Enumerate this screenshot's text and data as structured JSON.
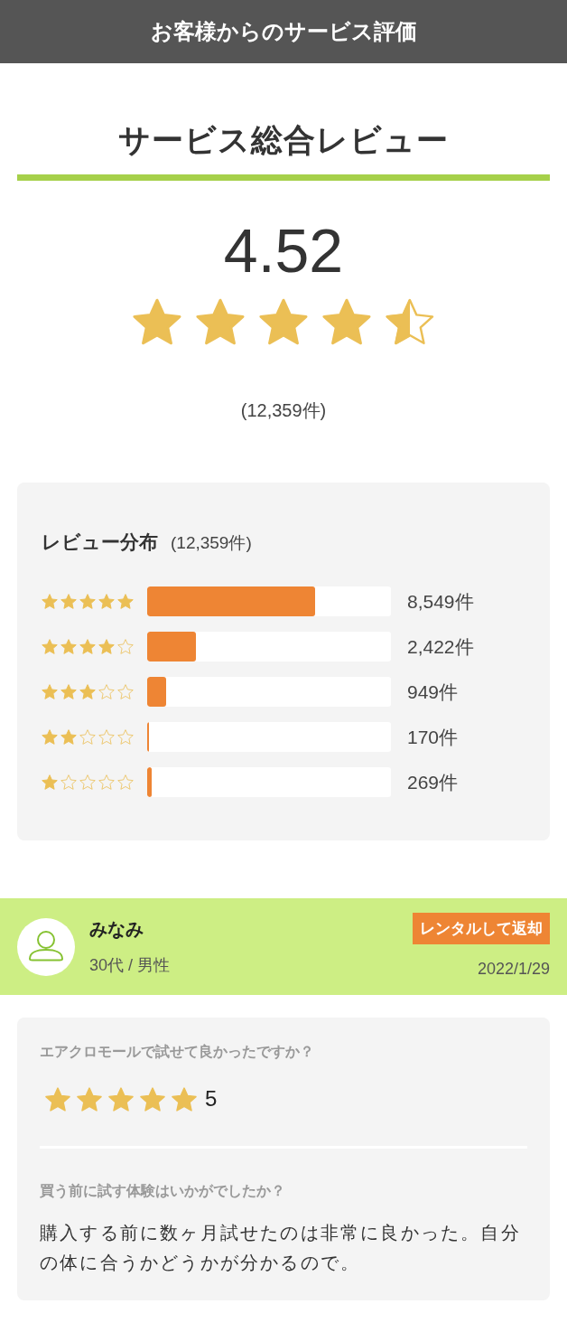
{
  "header": {
    "title": "お客様からのサービス評価"
  },
  "summary": {
    "title": "サービス総合レビュー",
    "score": "4.52",
    "stars": 4.5,
    "count": "(12,359件)"
  },
  "distribution": {
    "title": "レビュー分布",
    "count": "(12,359件)",
    "rows": [
      {
        "stars": 5,
        "level": 0.69,
        "count": "8,549件"
      },
      {
        "stars": 4,
        "level": 0.2,
        "count": "2,422件"
      },
      {
        "stars": 3,
        "level": 0.078,
        "count": "949件"
      },
      {
        "stars": 2,
        "level": 0.008,
        "count": "170件"
      },
      {
        "stars": 1,
        "level": 0.02,
        "count": "269件"
      }
    ]
  },
  "reviews": [
    {
      "reviewer": {
        "name": "みなみ",
        "meta": "30代 / 男性",
        "badge": "レンタルして返却",
        "date": "2022/1/29"
      },
      "questions": [
        {
          "kind": "rating",
          "question": "エアクロモールで試せて良かったですか？",
          "stars": 5,
          "value": "5"
        },
        {
          "kind": "text",
          "question": "買う前に試す体験はいかがでしたか？",
          "answer": "購入する前に数ヶ月試せたのは非常に良かった。自分の体に合うかどうかが分かるので。"
        }
      ]
    }
  ]
}
